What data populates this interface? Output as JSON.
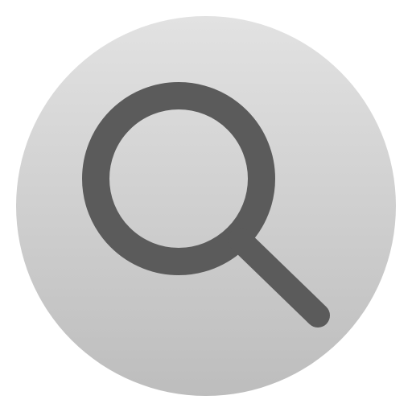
{
  "icon": {
    "name": "search-icon",
    "badge_shape": "circle",
    "colors": {
      "background_top": "#e2e2e2",
      "background_bottom": "#bdbdbd",
      "glyph": "#5b5b5b"
    }
  }
}
